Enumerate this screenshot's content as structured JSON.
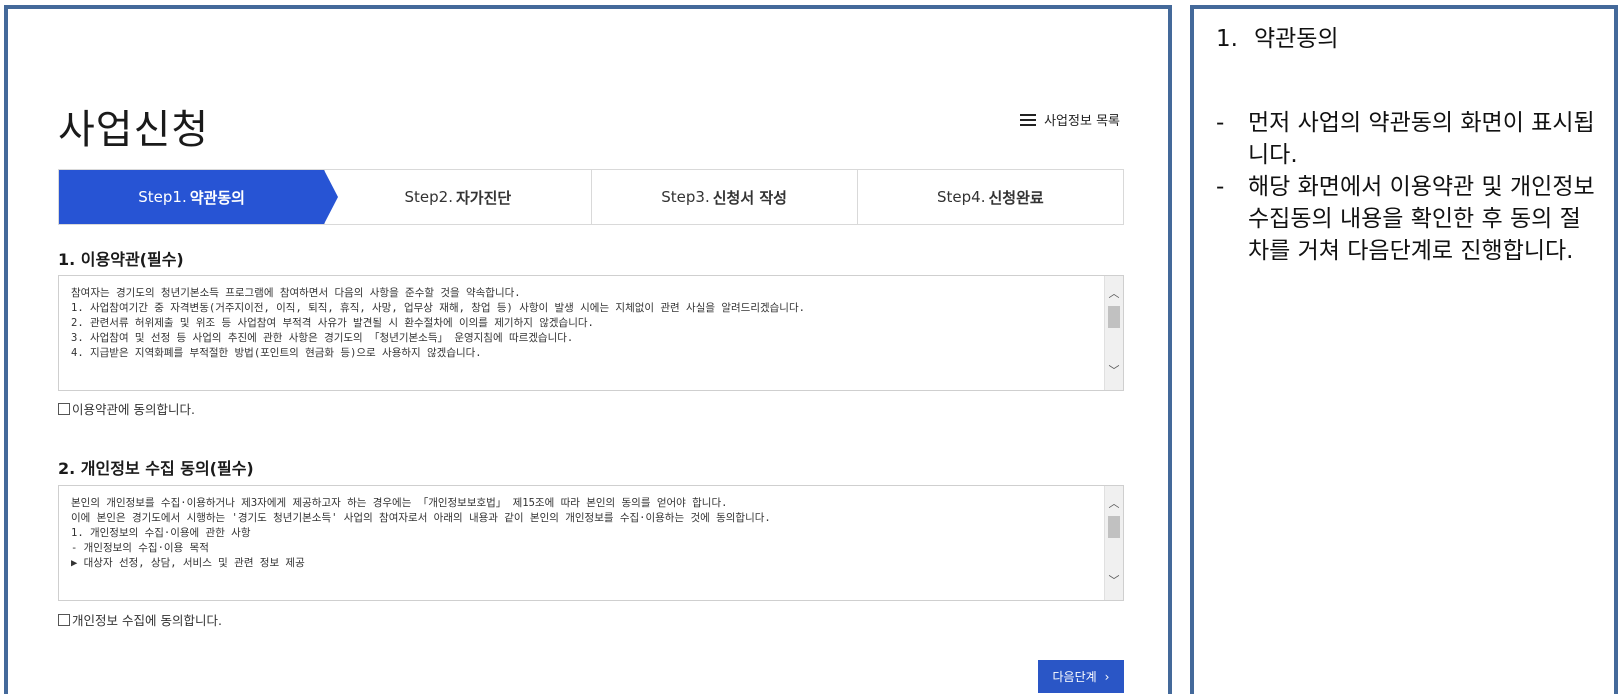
{
  "page": {
    "title": "사업신청",
    "list_link": "사업정보 목록",
    "steps": [
      {
        "prefix": "Step1.",
        "name": "약관동의",
        "active": true
      },
      {
        "prefix": "Step2.",
        "name": "자가진단",
        "active": false
      },
      {
        "prefix": "Step3.",
        "name": "신청서 작성",
        "active": false
      },
      {
        "prefix": "Step4.",
        "name": "신청완료",
        "active": false
      }
    ],
    "terms": {
      "title": "1. 이용약관(필수)",
      "lines": [
        "참여자는 경기도의 청년기본소득 프로그램에 참여하면서 다음의 사항을 준수할 것을 약속합니다.",
        "",
        "1. 사업참여기간 중 자격변동(거주지이전, 이직, 퇴직, 휴직, 사망, 업무상 재해, 창업 등) 사항이 발생 시에는 지체없이 관련 사실을 알려드리겠습니다.",
        "2. 관련서류 허위제출 및 위조 등 사업참여 부적격 사유가 발견될 시 환수절차에 이의를 제기하지 않겠습니다.",
        "3. 사업참여 및 선정 등 사업의 추진에 관한 사항은 경기도의 「청년기본소득」 운영지침에 따르겠습니다.",
        "4. 지급받은 지역화폐를 부적절한 방법(포인트의 현금화 등)으로 사용하지 않겠습니다."
      ],
      "agree_label": "이용약관에 동의합니다."
    },
    "privacy": {
      "title": "2. 개인정보 수집 동의(필수)",
      "lines": [
        "본인의 개인정보를 수집·이용하거나 제3자에게 제공하고자 하는 경우에는 「개인정보보호법」 제15조에 따라 본인의 동의를 얻어야 합니다.",
        "이에 본인은 경기도에서 시행하는 '경기도 청년기본소득' 사업의 참여자로서 아래의 내용과 같이 본인의 개인정보를 수집·이용하는 것에 동의합니다.",
        "",
        "1. 개인정보의 수집·이용에 관한 사항",
        "- 개인정보의 수집·이용 목적",
        "▶ 대상자 선정, 상담, 서비스 및 관련 정보 제공"
      ],
      "agree_label": "개인정보 수집에 동의합니다."
    },
    "next_button": "다음단계",
    "next_icon": "›"
  },
  "explanation": {
    "number": "1.",
    "heading": "약관동의",
    "bullets": [
      "먼저 사업의 약관동의 화면이 표시됩니다.",
      "해당 화면에서 이용약관 및 개인정보 수집동의 내용을 확인한 후 동의 절차를 거쳐 다음단계로 진행합니다."
    ]
  },
  "colors": {
    "frame_border": "#44699a",
    "active_step": "#2754d4",
    "button": "#2a56c6"
  }
}
